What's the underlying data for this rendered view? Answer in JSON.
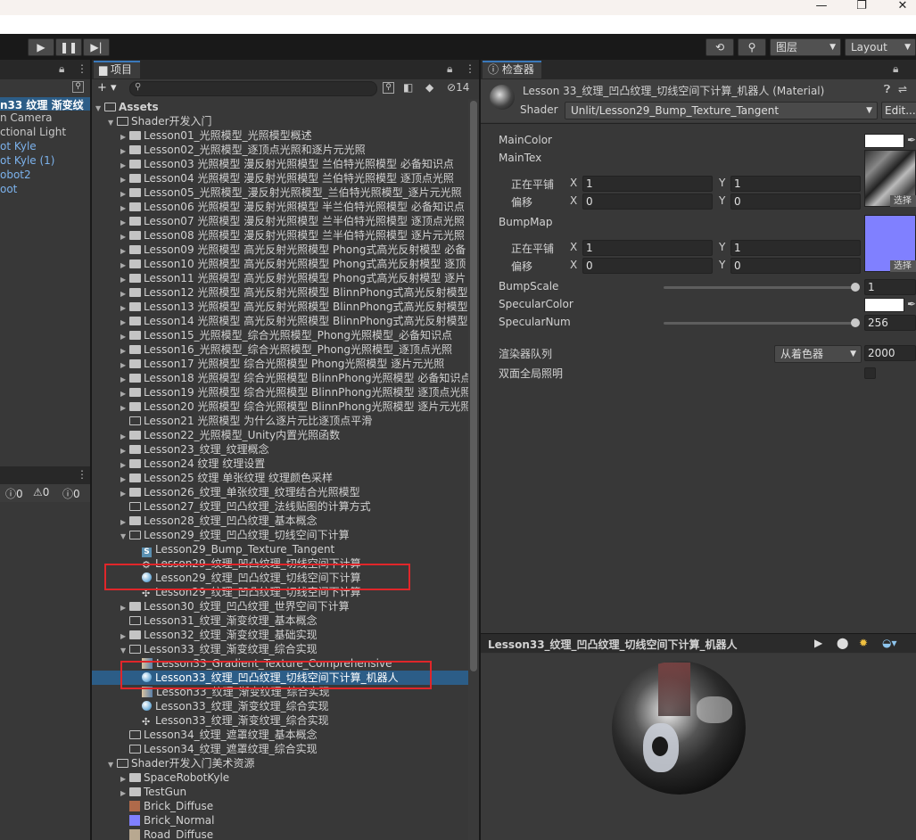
{
  "window": {
    "minimize_icon": "—",
    "restore_icon": "❐",
    "close_icon": "✕"
  },
  "toolbar": {
    "play": "▶",
    "pause": "❚❚",
    "step": "▶|",
    "history_icon": "⟲",
    "search_icon": "⚲",
    "layers_label": "图层",
    "layout_label": "Layout"
  },
  "hierarchy": {
    "items": [
      "n33 纹理 渐变纹",
      "n Camera",
      "ctional Light",
      "ot Kyle",
      "ot Kyle (1)",
      "obot2",
      "oot"
    ],
    "console_counts": [
      "0",
      "0",
      "0"
    ]
  },
  "project": {
    "tab": "项目",
    "add": "+ ▾",
    "count": "14",
    "rows": [
      {
        "level": 0,
        "fold": "▼",
        "icon": "folder-open",
        "label": "Assets",
        "bold": true
      },
      {
        "level": 1,
        "fold": "▼",
        "icon": "folder-open",
        "label": "Shader开发入门"
      },
      {
        "level": 2,
        "fold": "▶",
        "icon": "folder",
        "label": "Lesson01_光照模型_光照模型概述"
      },
      {
        "level": 2,
        "fold": "▶",
        "icon": "folder",
        "label": "Lesson02_光照模型_逐顶点光照和逐片元光照"
      },
      {
        "level": 2,
        "fold": "▶",
        "icon": "folder",
        "label": "Lesson03 光照模型 漫反射光照模型 兰伯特光照模型 必备知识点"
      },
      {
        "level": 2,
        "fold": "▶",
        "icon": "folder",
        "label": "Lesson04 光照模型 漫反射光照模型 兰伯特光照模型 逐顶点光照"
      },
      {
        "level": 2,
        "fold": "▶",
        "icon": "folder",
        "label": "Lesson05_光照模型_漫反射光照模型_兰伯特光照模型_逐片元光照"
      },
      {
        "level": 2,
        "fold": "▶",
        "icon": "folder",
        "label": "Lesson06 光照模型 漫反射光照模型 半兰伯特光照模型 必备知识点"
      },
      {
        "level": 2,
        "fold": "▶",
        "icon": "folder",
        "label": "Lesson07 光照模型 漫反射光照模型 兰半伯特光照模型 逐顶点光照"
      },
      {
        "level": 2,
        "fold": "▶",
        "icon": "folder",
        "label": "Lesson08 光照模型 漫反射光照模型 兰半伯特光照模型 逐片元光照"
      },
      {
        "level": 2,
        "fold": "▶",
        "icon": "folder",
        "label": "Lesson09 光照模型 高光反射光照模型 Phong式高光反射模型 必备"
      },
      {
        "level": 2,
        "fold": "▶",
        "icon": "folder",
        "label": "Lesson10 光照模型 高光反射光照模型 Phong式高光反射模型 逐顶"
      },
      {
        "level": 2,
        "fold": "▶",
        "icon": "folder",
        "label": "Lesson11 光照模型 高光反射光照模型 Phong式高光反射模型 逐片"
      },
      {
        "level": 2,
        "fold": "▶",
        "icon": "folder",
        "label": "Lesson12 光照模型 高光反射光照模型 BlinnPhong式高光反射模型"
      },
      {
        "level": 2,
        "fold": "▶",
        "icon": "folder",
        "label": "Lesson13 光照模型 高光反射光照模型 BlinnPhong式高光反射模型"
      },
      {
        "level": 2,
        "fold": "▶",
        "icon": "folder",
        "label": "Lesson14 光照模型 高光反射光照模型 BlinnPhong式高光反射模型"
      },
      {
        "level": 2,
        "fold": "▶",
        "icon": "folder",
        "label": "Lesson15_光照模型_综合光照模型_Phong光照模型_必备知识点"
      },
      {
        "level": 2,
        "fold": "▶",
        "icon": "folder",
        "label": "Lesson16_光照模型_综合光照模型_Phong光照模型_逐顶点光照"
      },
      {
        "level": 2,
        "fold": "▶",
        "icon": "folder",
        "label": "Lesson17 光照模型 综合光照模型 Phong光照模型 逐片元光照"
      },
      {
        "level": 2,
        "fold": "▶",
        "icon": "folder",
        "label": "Lesson18 光照模型 综合光照模型 BlinnPhong光照模型 必备知识点"
      },
      {
        "level": 2,
        "fold": "▶",
        "icon": "folder",
        "label": "Lesson19 光照模型 综合光照模型 BlinnPhong光照模型 逐顶点光照"
      },
      {
        "level": 2,
        "fold": "▶",
        "icon": "folder",
        "label": "Lesson20 光照模型 综合光照模型 BlinnPhong光照模型 逐片元光照"
      },
      {
        "level": 2,
        "fold": "",
        "icon": "folder-empty",
        "label": "Lesson21 光照模型 为什么逐片元比逐顶点平滑"
      },
      {
        "level": 2,
        "fold": "▶",
        "icon": "folder",
        "label": "Lesson22_光照模型_Unity内置光照函数"
      },
      {
        "level": 2,
        "fold": "▶",
        "icon": "folder",
        "label": "Lesson23_纹理_纹理概念"
      },
      {
        "level": 2,
        "fold": "▶",
        "icon": "folder",
        "label": "Lesson24 纹理 纹理设置"
      },
      {
        "level": 2,
        "fold": "▶",
        "icon": "folder",
        "label": "Lesson25 纹理 单张纹理 纹理颜色采样"
      },
      {
        "level": 2,
        "fold": "▶",
        "icon": "folder",
        "label": "Lesson26_纹理_单张纹理_纹理结合光照模型"
      },
      {
        "level": 2,
        "fold": "",
        "icon": "folder-empty",
        "label": "Lesson27_纹理_凹凸纹理_法线贴图的计算方式"
      },
      {
        "level": 2,
        "fold": "▶",
        "icon": "folder",
        "label": "Lesson28_纹理_凹凸纹理_基本概念"
      },
      {
        "level": 2,
        "fold": "▼",
        "icon": "folder-open",
        "label": "Lesson29_纹理_凹凸纹理_切线空间下计算"
      },
      {
        "level": 3,
        "fold": "",
        "icon": "shader",
        "label": "Lesson29_Bump_Texture_Tangent"
      },
      {
        "level": 3,
        "fold": "",
        "icon": "gear",
        "label": "Lesson29_纹理_凹凸纹理_切线空间下计算"
      },
      {
        "level": 3,
        "fold": "",
        "icon": "material",
        "label": "Lesson29_纹理_凹凸纹理_切线空间下计算"
      },
      {
        "level": 3,
        "fold": "",
        "icon": "unity",
        "label": "Lesson29_纹理_凹凸纹理_切线空间下计算"
      },
      {
        "level": 2,
        "fold": "▶",
        "icon": "folder",
        "label": "Lesson30_纹理_凹凸纹理_世界空间下计算"
      },
      {
        "level": 2,
        "fold": "",
        "icon": "folder-empty",
        "label": "Lesson31_纹理_渐变纹理_基本概念"
      },
      {
        "level": 2,
        "fold": "▶",
        "icon": "folder",
        "label": "Lesson32_纹理_渐变纹理_基础实现"
      },
      {
        "level": 2,
        "fold": "▼",
        "icon": "folder-open",
        "label": "Lesson33_纹理_渐变纹理_综合实现"
      },
      {
        "level": 3,
        "fold": "",
        "icon": "texture",
        "label": "Lesson33_Gradient_Texture_Comprehensive"
      },
      {
        "level": 3,
        "fold": "",
        "icon": "material",
        "label": "Lesson33_纹理_凹凸纹理_切线空间下计算_机器人",
        "selected": true
      },
      {
        "level": 3,
        "fold": "",
        "icon": "texture",
        "label": "Lesson33_纹理_渐变纹理_综合实现"
      },
      {
        "level": 3,
        "fold": "",
        "icon": "material",
        "label": "Lesson33_纹理_渐变纹理_综合实现"
      },
      {
        "level": 3,
        "fold": "",
        "icon": "unity",
        "label": "Lesson33_纹理_渐变纹理_综合实现"
      },
      {
        "level": 2,
        "fold": "",
        "icon": "folder-empty",
        "label": "Lesson34_纹理_遮罩纹理_基本概念"
      },
      {
        "level": 2,
        "fold": "",
        "icon": "folder-empty",
        "label": "Lesson34_纹理_遮罩纹理_综合实现"
      },
      {
        "level": 1,
        "fold": "▼",
        "icon": "folder-open",
        "label": "Shader开发入门美术资源"
      },
      {
        "level": 2,
        "fold": "▶",
        "icon": "folder",
        "label": "SpaceRobotKyle"
      },
      {
        "level": 2,
        "fold": "▶",
        "icon": "folder",
        "label": "TestGun"
      },
      {
        "level": 2,
        "fold": "",
        "icon": "brick-diffuse",
        "label": "Brick_Diffuse"
      },
      {
        "level": 2,
        "fold": "",
        "icon": "brick-normal",
        "label": "Brick_Normal"
      },
      {
        "level": 2,
        "fold": "",
        "icon": "road-diffuse",
        "label": "Road_Diffuse"
      }
    ]
  },
  "inspector": {
    "tab": "检查器",
    "title": "Lesson 33_纹理_凹凸纹理_切线空间下计算_机器人 (Material)",
    "shader_label": "Shader",
    "shader_value": "Unlit/Lesson29_Bump_Texture_Tangent",
    "edit_label": "Edit...",
    "props": {
      "main_color": "MainColor",
      "main_tex": "MainTex",
      "tiling": "正在平铺",
      "offset": "偏移",
      "x": "X",
      "y": "Y",
      "main_tiling_x": "1",
      "main_tiling_y": "1",
      "main_offset_x": "0",
      "main_offset_y": "0",
      "bump_map": "BumpMap",
      "bump_tiling_x": "1",
      "bump_tiling_y": "1",
      "bump_offset_x": "0",
      "bump_offset_y": "0",
      "select": "选择",
      "bump_scale": "BumpScale",
      "bump_scale_value": "1",
      "specular_color": "SpecularColor",
      "specular_num": "SpecularNum",
      "specular_num_value": "256",
      "render_queue": "渲染器队列",
      "render_queue_mode": "从着色器",
      "render_queue_value": "2000",
      "double_sided_gi": "双面全局照明"
    },
    "preview_title": "Lesson33_纹理_凹凸纹理_切线空间下计算_机器人"
  },
  "colors": {
    "accent": "#3a79bb",
    "selection": "#2c5d87",
    "highlight_box": "#e0262a",
    "bump_color": "#8080ff"
  }
}
